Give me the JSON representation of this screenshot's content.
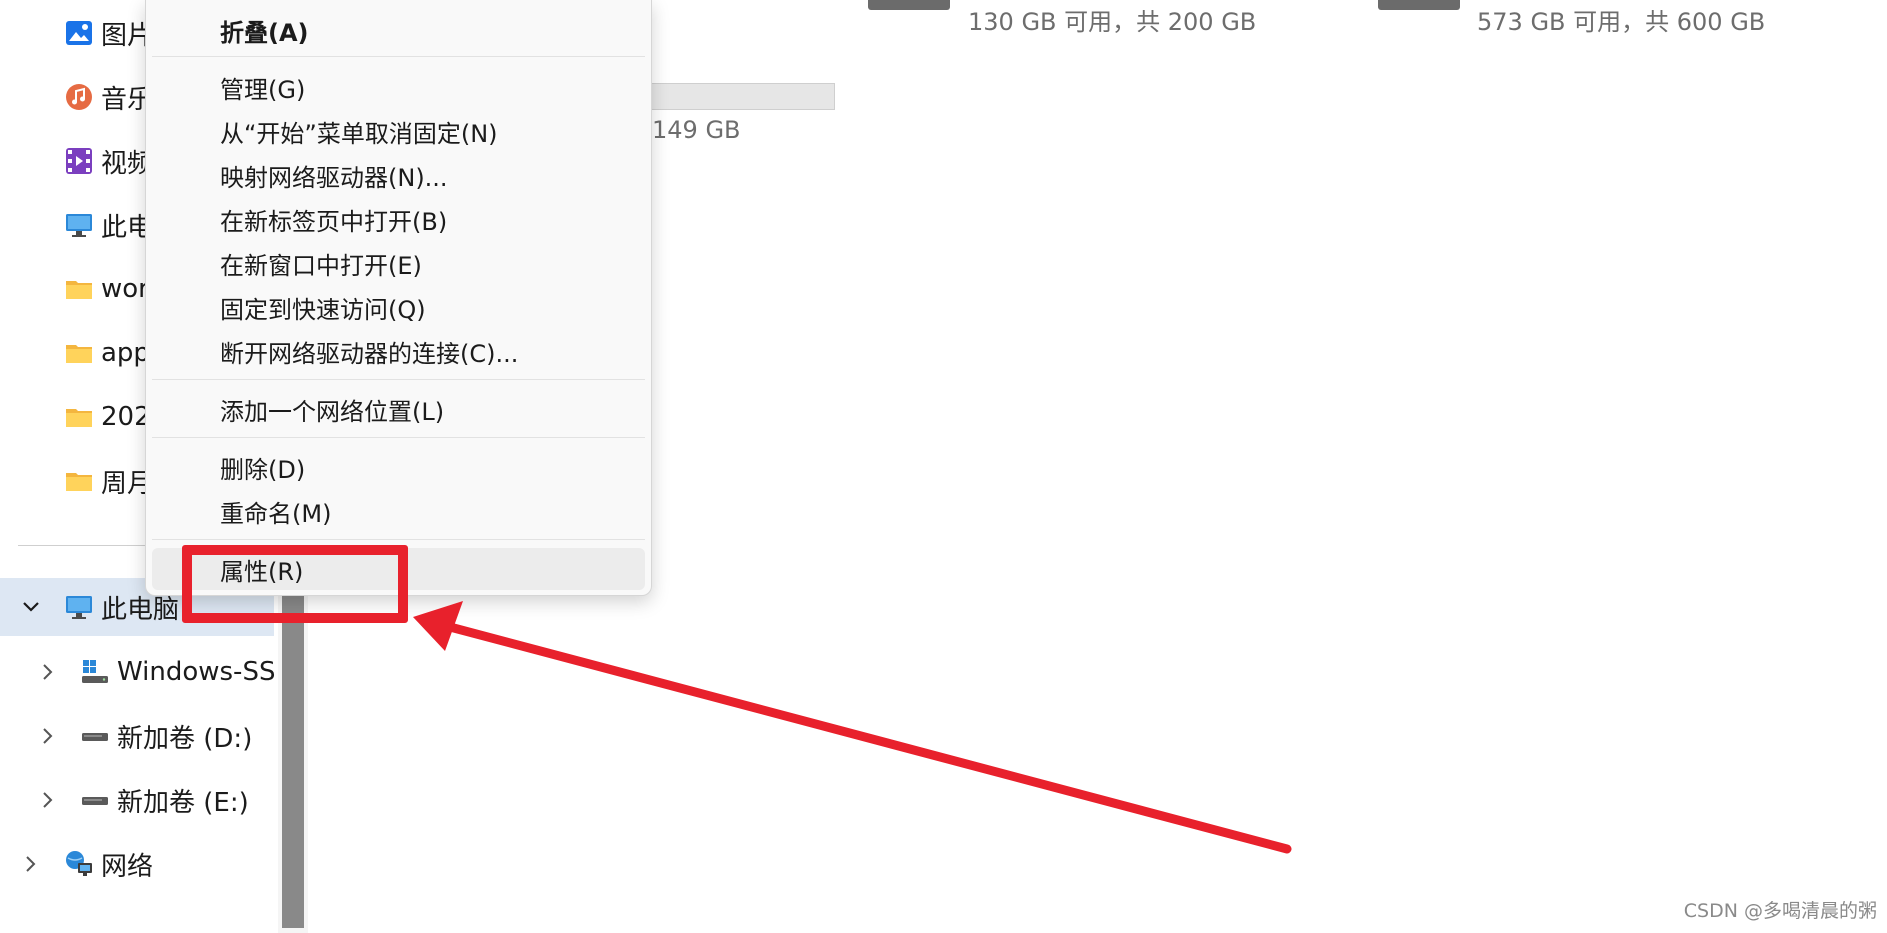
{
  "sidebar": {
    "quick_items": [
      {
        "label": "图片",
        "icon": "pictures-icon"
      },
      {
        "label": "音乐",
        "icon": "music-icon"
      },
      {
        "label": "视频",
        "icon": "videos-icon"
      },
      {
        "label": "此电",
        "icon": "monitor-icon"
      },
      {
        "label": "wor",
        "icon": "folder-icon"
      },
      {
        "label": "app",
        "icon": "folder-icon"
      },
      {
        "label": "202",
        "icon": "folder-icon"
      },
      {
        "label": "周月",
        "icon": "folder-icon"
      }
    ],
    "this_pc": {
      "label": "此电脑",
      "icon": "monitor-icon",
      "expanded": true
    },
    "drives": [
      {
        "label": "Windows-SSD",
        "icon": "windows-drive-icon"
      },
      {
        "label": "新加卷 (D:)",
        "icon": "drive-icon"
      },
      {
        "label": "新加卷 (E:)",
        "icon": "drive-icon"
      }
    ],
    "network": {
      "label": "网络",
      "icon": "network-icon"
    }
  },
  "drives_view": {
    "tiles": [
      {
        "free_text": "130 GB 可用，共 200 GB"
      },
      {
        "free_text": "573 GB 可用，共 600 GB"
      },
      {
        "free_text": "149 GB"
      }
    ]
  },
  "context_menu": {
    "items": [
      {
        "label": "折叠(A)",
        "bold": true
      },
      {
        "label": "管理(G)"
      },
      {
        "label": "从“开始”菜单取消固定(N)"
      },
      {
        "label": "映射网络驱动器(N)..."
      },
      {
        "label": "在新标签页中打开(B)"
      },
      {
        "label": "在新窗口中打开(E)"
      },
      {
        "label": "固定到快速访问(Q)"
      },
      {
        "label": "断开网络驱动器的连接(C)..."
      },
      {
        "label": "添加一个网络位置(L)"
      },
      {
        "label": "删除(D)"
      },
      {
        "label": "重命名(M)"
      },
      {
        "label": "属性(R)",
        "highlighted": true
      }
    ]
  },
  "annotation": {
    "color": "#e8212c"
  },
  "watermark": "CSDN @多喝清晨的粥",
  "colors": {
    "selection": "#dde7f3",
    "menu_bg": "#f9f9f9",
    "accent_red": "#e8212c"
  }
}
